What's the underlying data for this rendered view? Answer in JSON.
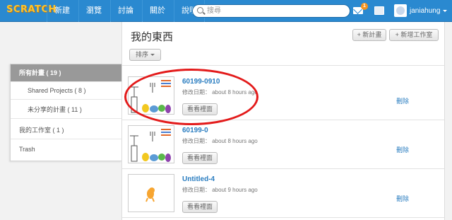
{
  "topbar": {
    "logo": "SCRATCH",
    "nav": [
      "新建",
      "瀏覽",
      "討論",
      "關於",
      "說明"
    ],
    "search_placeholder": "搜尋",
    "notification_count": "1",
    "username": "janiahung"
  },
  "page": {
    "title": "我的東西",
    "new_project_label": "+ 新計畫",
    "new_studio_label": "+ 新增工作室",
    "sort_label": "排序"
  },
  "sidebar": {
    "items": [
      {
        "label": "所有計畫 ( 19 )"
      },
      {
        "label": "Shared Projects ( 8 )"
      },
      {
        "label": "未分享的計畫 ( 11 )"
      },
      {
        "label": "我的工作室 ( 1 )"
      },
      {
        "label": "Trash"
      }
    ]
  },
  "projects": [
    {
      "title": "60199-0910",
      "modified": "修改日期： about 8 hours ago",
      "view_label": "看看裡面",
      "delete_label": "刪除"
    },
    {
      "title": "60199-0",
      "modified": "修改日期： about 8 hours ago",
      "view_label": "看看裡面",
      "delete_label": "刪除"
    },
    {
      "title": "Untitled-4",
      "modified": "修改日期： about 9 hours ago",
      "view_label": "看看裡面",
      "delete_label": "刪除"
    }
  ],
  "colors": {
    "topbar": "#2a89d0",
    "link": "#2a7dc0",
    "highlight": "#e31b1b",
    "badge": "#f7941d"
  },
  "icons": [
    "search-icon",
    "mail-icon",
    "folder-icon",
    "avatar",
    "chevron-down-icon"
  ]
}
